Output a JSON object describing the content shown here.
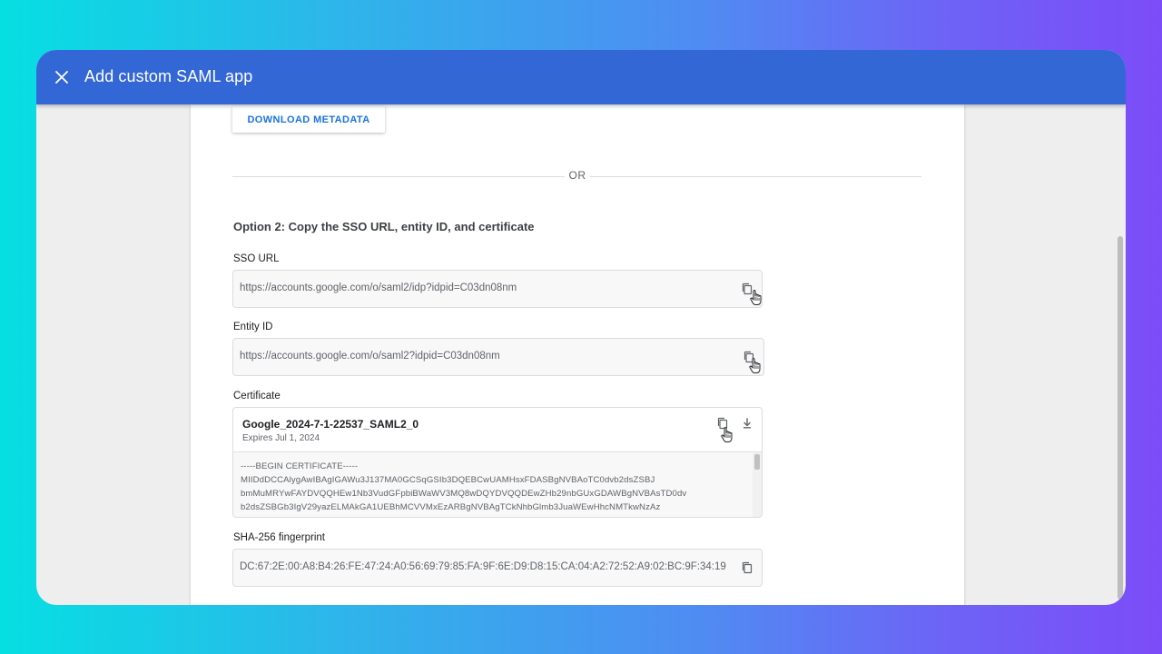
{
  "window": {
    "title": "Add custom SAML app",
    "close_icon": "close-icon"
  },
  "download": {
    "label": "DOWNLOAD METADATA"
  },
  "divider": {
    "text": "OR"
  },
  "option2": {
    "title": "Option 2: Copy the SSO URL, entity ID, and certificate"
  },
  "sso": {
    "label": "SSO URL",
    "value": "https://accounts.google.com/o/saml2/idp?idpid=C03dn08nm"
  },
  "entity": {
    "label": "Entity ID",
    "value": "https://accounts.google.com/o/saml2?idpid=C03dn08nm"
  },
  "certificate": {
    "label": "Certificate",
    "name": "Google_2024-7-1-22537_SAML2_0",
    "expires": "Expires Jul 1, 2024",
    "lines": [
      "-----BEGIN CERTIFICATE-----",
      "MIIDdDCCAlygAwIBAgIGAWu3J137MA0GCSqGSIb3DQEBCwUAMHsxFDASBgNVBAoTC0dvb2dsZSBJ",
      "bmMuMRYwFAYDVQQHEw1Nb3VudGFpbiBWaWV3MQ8wDQYDVQQDEwZHb29nbGUxGDAWBgNVBAsTD0dv",
      "b2dsZSBGb3IgV29yazELMAkGA1UEBhMCVVMxEzARBgNVBAgTCkNhbGlmb3JuaWEwHhcNMTkwNzAz"
    ]
  },
  "fingerprint": {
    "label": "SHA-256 fingerprint",
    "value": "DC:67:2E:00:A8:B4:26:FE:47:24:A0:56:69:79:85:FA:9F:6E:D9:D8:15:CA:04:A2:72:52:A9:02:BC:9F:34:19"
  },
  "colors": {
    "appbar": "#3367d6",
    "accent": "#1a73e8",
    "background_gradient_start": "#06dfe2",
    "background_gradient_end": "#7c4cf8"
  }
}
